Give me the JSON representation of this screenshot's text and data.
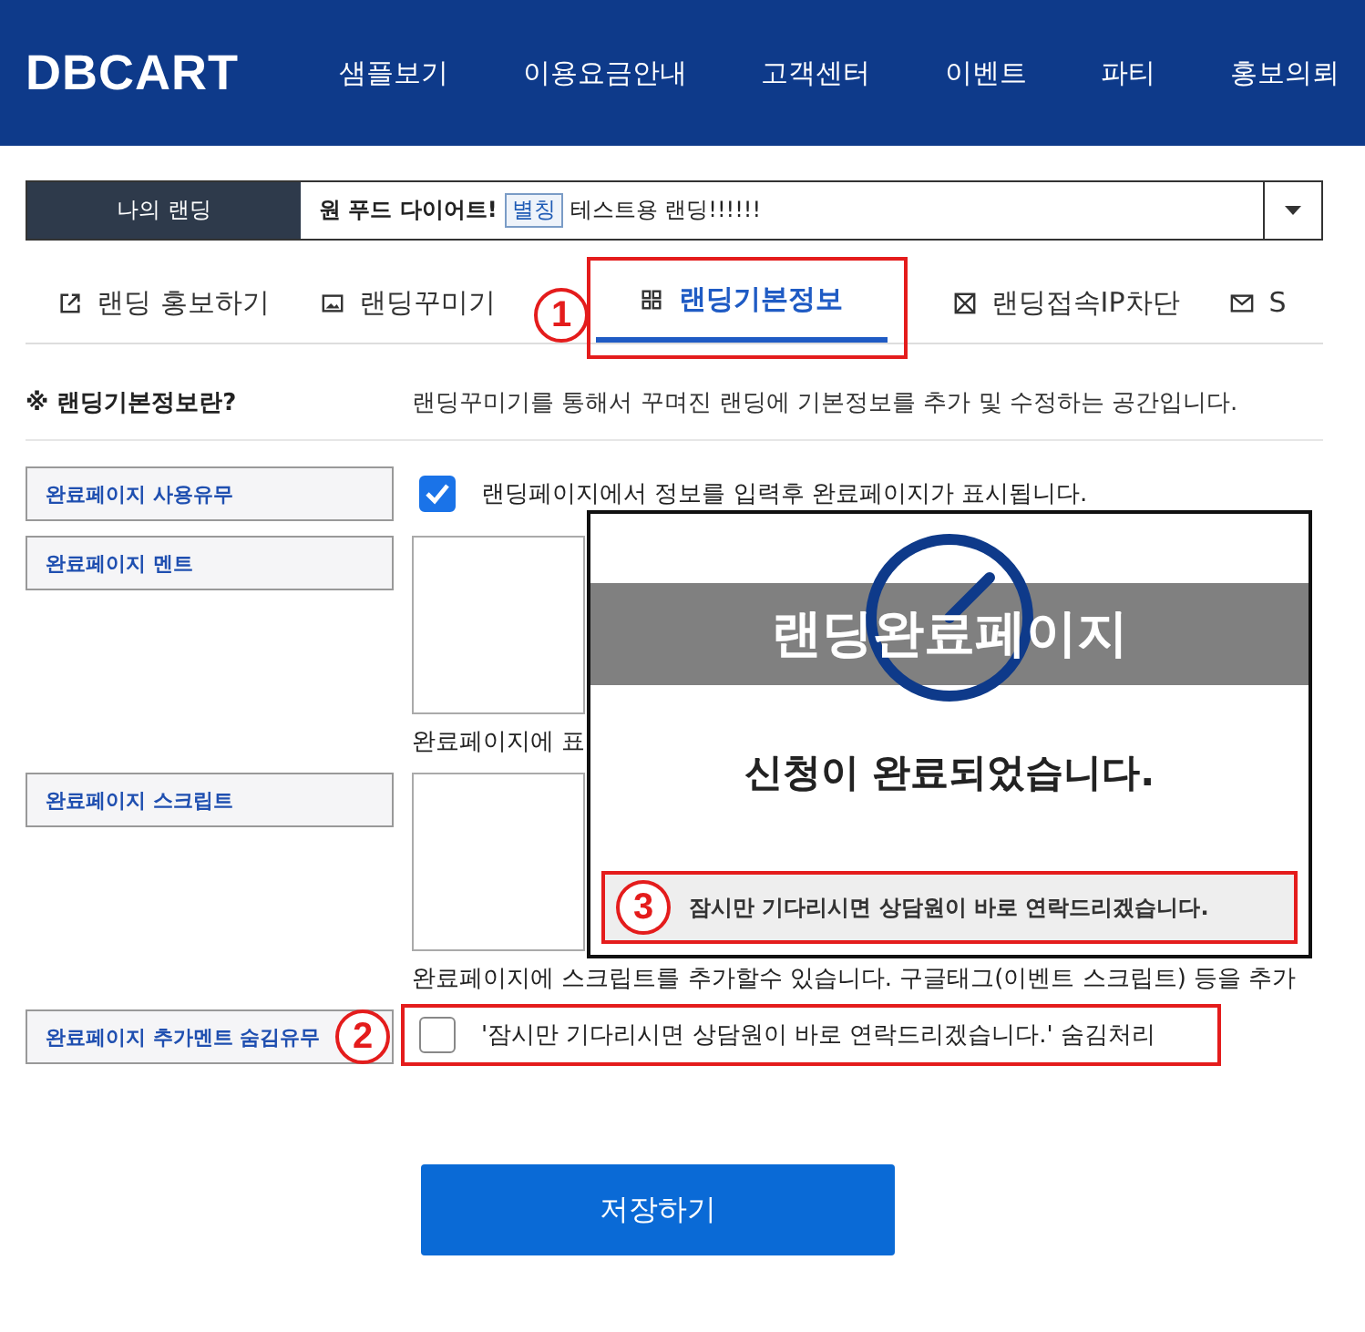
{
  "header": {
    "logo": "DBCART",
    "nav": [
      "샘플보기",
      "이용요금안내",
      "고객센터",
      "이벤트",
      "파티",
      "홍보의뢰"
    ]
  },
  "landing_selector": {
    "label": "나의 랜딩",
    "name": "원 푸드 다이어트!",
    "tag": "별칭",
    "title": "테스트용 랜딩!!!!!!"
  },
  "tabs": [
    {
      "label": "랜딩 홍보하기",
      "selected": false
    },
    {
      "label": "랜딩꾸미기",
      "selected": false
    },
    {
      "label": "랜딩기본정보",
      "selected": true,
      "marker": "1"
    },
    {
      "label": "랜딩접속IP차단",
      "selected": false
    },
    {
      "label": "S",
      "selected": false
    }
  ],
  "info": {
    "label": "※ 랜딩기본정보란?",
    "text": "랜딩꾸미기를 통해서 꾸며진 랜딩에 기본정보를 추가 및 수정하는 공간입니다."
  },
  "form": [
    {
      "kind": "checkbox",
      "label": "완료페이지 사용유무",
      "checked": true,
      "text": "랜딩페이지에서 정보를 입력후 완료페이지가 표시됩니다."
    },
    {
      "kind": "textarea",
      "label": "완료페이지 멘트",
      "help": "완료페이지에 표"
    },
    {
      "kind": "textarea",
      "label": "완료페이지 스크립트",
      "help": "완료페이지에 스크립트를 추가할수 있습니다. 구글태그(이벤트 스크립트) 등을 추가"
    },
    {
      "kind": "checkbox",
      "label": "완료페이지 추가멘트 숨김유무",
      "checked": false,
      "text": "'잠시만 기다리시면 상담원이 바로 연락드리겠습니다.' 숨김처리",
      "marker": "2"
    }
  ],
  "popup": {
    "title": "랜딩완료페이지",
    "message": "신청이 완료되었습니다.",
    "note": "잠시만 기다리시면 상담원이 바로 연락드리겠습니다.",
    "marker": "3"
  },
  "save_button": "저장하기"
}
